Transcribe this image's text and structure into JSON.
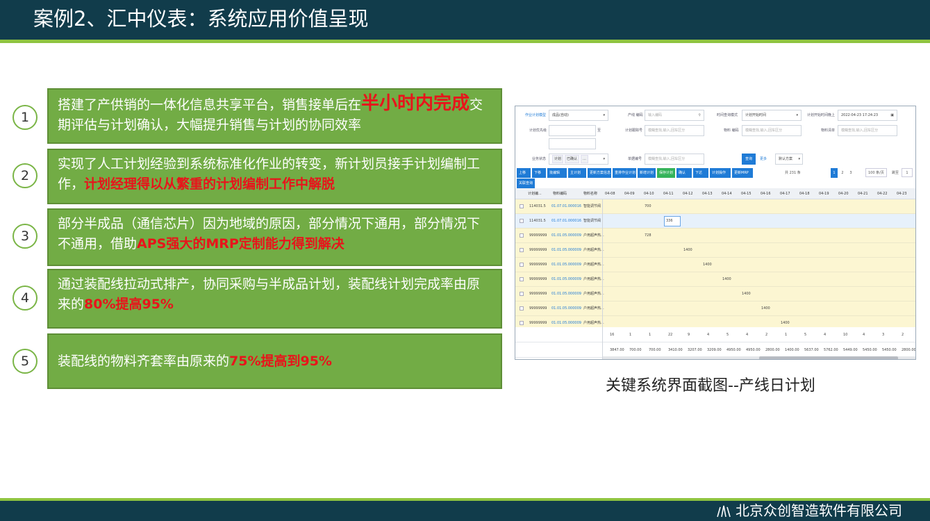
{
  "header": {
    "title": "案例2、汇中仪表：系统应用价值呈现"
  },
  "footer": {
    "company": "北京众创智造软件有限公司"
  },
  "items": [
    {
      "num": "1",
      "parts": [
        {
          "text": "搭建了产供销的一体化信息共享平台，销售接单后在",
          "style": "normal"
        },
        {
          "text": "半小时内完成",
          "style": "red-big"
        },
        {
          "text": "交期评估与计划确认，大幅提升销售与计划的协同效率",
          "style": "normal"
        }
      ]
    },
    {
      "num": "2",
      "parts": [
        {
          "text": "实现了人工计划经验到系统标准化作业的转变，新计划员接手计划编制工作，",
          "style": "normal"
        },
        {
          "text": "计划经理得以从繁重的计划编制工作中解脱",
          "style": "red"
        }
      ]
    },
    {
      "num": "3",
      "parts": [
        {
          "text": "部分半成品（通信芯片）因为地域的原因，部分情况下通用，部分情况下不通用，借助",
          "style": "normal"
        },
        {
          "text": "APS强大的MRP定制能力得到解决",
          "style": "red"
        }
      ]
    },
    {
      "num": "4",
      "parts": [
        {
          "text": "通过装配线拉动式排产，协同采购与半成品计划，装配线计划完成率由原来的",
          "style": "normal"
        },
        {
          "text": "80%提高95%",
          "style": "red"
        }
      ]
    },
    {
      "num": "5",
      "parts": [
        {
          "text": "装配线的物料齐套率由原来的",
          "style": "normal"
        },
        {
          "text": "75%提高到95%",
          "style": "red"
        }
      ]
    }
  ],
  "caption": "关键系统界面截图--产线日计划",
  "screenshot": {
    "filters": {
      "plan_model_label": "作业计划模型",
      "plan_model_value": "成品(自动)",
      "line_label": "产线 编码",
      "line_placeholder": "输入编码",
      "time_mode_label": "时间查询模式",
      "time_mode_value": "计划开始时间",
      "start_after_label": "计划开始时间晚上",
      "start_after_value": "2022-04-23 17:24:23",
      "priority_label": "计划优先级",
      "to_label": "至",
      "track_label": "计划跟踪号",
      "track_placeholder": "模糊查找,输入,回车区分",
      "material_label": "物料 编码",
      "material_placeholder": "模糊查找,输入,回车区分",
      "bom_label": "物料清单",
      "bom_placeholder": "模糊查找,输入,回车区分",
      "status_label": "业务状态",
      "status_tags": [
        "计划",
        "已确认",
        "..."
      ],
      "doc_label": "单据编号",
      "doc_placeholder": "模糊查找,输入,回车区分",
      "query": "查询",
      "more": "更多",
      "scheme": "默认方案"
    },
    "toolbar": [
      "上移",
      "下移",
      "批编辑",
      "主计划",
      "更新方案信息",
      "重排作业计划",
      "新增计划",
      "保存计划",
      "确认",
      "下达",
      "计划操作",
      "更新MRP"
    ],
    "toolbar2": "关联查询",
    "pagination": {
      "total": "共 231 条",
      "pages": [
        "1",
        "2",
        "3"
      ],
      "per_page": "100 条/页",
      "goto": "跳至",
      "goto_value": "1"
    },
    "columns": {
      "plan": "计划编...",
      "material": "物料编码",
      "name": "物料名称"
    },
    "dates": [
      "04-08",
      "04-09",
      "04-10",
      "04-11",
      "04-12",
      "04-13",
      "04-14",
      "04-15",
      "04-16",
      "04-17",
      "04-18",
      "04-19",
      "04-20",
      "04-21",
      "04-22",
      "04-23"
    ],
    "rows": [
      {
        "plan": "114031.5",
        "material": "01.07.01.000016",
        "name": "智能调节阀",
        "values": [
          "",
          "",
          "700",
          "",
          "",
          "",
          "",
          "",
          "",
          "",
          "",
          "",
          "",
          "",
          "",
          ""
        ]
      },
      {
        "plan": "114031.5",
        "material": "01.07.01.000016",
        "name": "智能调节阀",
        "values": [
          "",
          "",
          "",
          "336",
          "",
          "",
          "",
          "",
          "",
          "",
          "",
          "",
          "",
          "",
          "",
          ""
        ]
      },
      {
        "plan": "99999999",
        "material": "01.01.05.000009",
        "name": "户用超声热...",
        "values": [
          "",
          "",
          "728",
          "",
          "",
          "",
          "",
          "",
          "",
          "",
          "",
          "",
          "",
          "",
          "",
          ""
        ]
      },
      {
        "plan": "99999999",
        "material": "01.01.05.000009",
        "name": "户用超声热...",
        "values": [
          "",
          "",
          "",
          "",
          "1400",
          "",
          "",
          "",
          "",
          "",
          "",
          "",
          "",
          "",
          "",
          ""
        ]
      },
      {
        "plan": "99999999",
        "material": "01.01.05.000009",
        "name": "户用超声热...",
        "values": [
          "",
          "",
          "",
          "",
          "",
          "1400",
          "",
          "",
          "",
          "",
          "",
          "",
          "",
          "",
          "",
          ""
        ]
      },
      {
        "plan": "99999999",
        "material": "01.01.05.000009",
        "name": "户用超声热...",
        "values": [
          "",
          "",
          "",
          "",
          "",
          "",
          "1400",
          "",
          "",
          "",
          "",
          "",
          "",
          "",
          "",
          ""
        ]
      },
      {
        "plan": "99999999",
        "material": "01.01.05.000009",
        "name": "户用超声热...",
        "values": [
          "",
          "",
          "",
          "",
          "",
          "",
          "",
          "1400",
          "",
          "",
          "",
          "",
          "",
          "",
          "",
          ""
        ]
      },
      {
        "plan": "99999999",
        "material": "01.01.05.000009",
        "name": "户用超声热...",
        "values": [
          "",
          "",
          "",
          "",
          "",
          "",
          "",
          "",
          "1400",
          "",
          "",
          "",
          "",
          "",
          "",
          ""
        ]
      },
      {
        "plan": "99999999",
        "material": "01.01.05.000009",
        "name": "户用超声热...",
        "values": [
          "",
          "",
          "",
          "",
          "",
          "",
          "",
          "",
          "",
          "1400",
          "",
          "",
          "",
          "",
          "",
          ""
        ]
      }
    ],
    "count_row": [
      "16",
      "1",
      "1",
      "22",
      "9",
      "4",
      "5",
      "4",
      "2",
      "1",
      "5",
      "4",
      "10",
      "4",
      "3",
      "2"
    ],
    "sum_row": [
      "3847.00",
      "700.00",
      "700.00",
      "3410.00",
      "3207.00",
      "3209.00",
      "4950.00",
      "4950.00",
      "2800.00",
      "1400.00",
      "5637.00",
      "5762.00",
      "5449.00",
      "5450.00",
      "5450.00",
      "2800.00"
    ]
  },
  "colors": {
    "header_bg": "#113c4b",
    "accent_green": "#8fc440",
    "box_green": "#72ac45",
    "highlight_red": "#e8141b"
  }
}
